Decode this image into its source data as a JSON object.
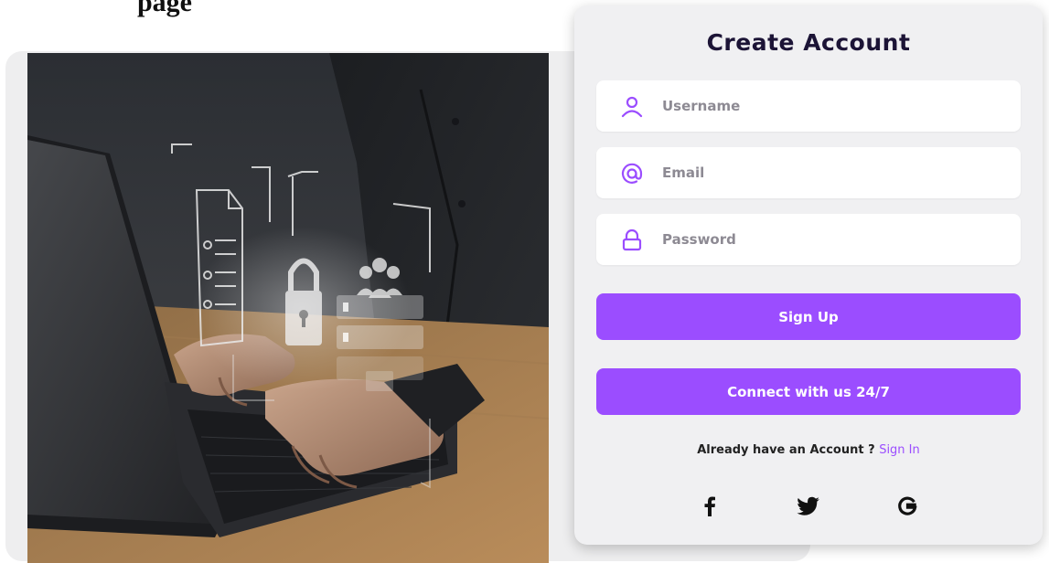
{
  "page": {
    "clipped_heading": "page"
  },
  "form": {
    "title": "Create Account",
    "username_placeholder": "Username",
    "email_placeholder": "Email",
    "password_placeholder": "Password",
    "signup_label": "Sign Up",
    "connect_label": "Connect with us 24/7",
    "already_text": "Already have an Account ? ",
    "signin_label": "Sign In",
    "icons": {
      "username": "user-icon",
      "email": "at-sign-icon",
      "password": "lock-icon"
    }
  },
  "social": [
    {
      "icon": "facebook-icon",
      "glyph": "f"
    },
    {
      "icon": "twitter-icon",
      "glyph": "bird"
    },
    {
      "icon": "google-icon",
      "glyph": "G"
    }
  ],
  "theme": {
    "accent": "#9b4dff",
    "title_color": "#1c1436",
    "card_bg": "#f0f0f2"
  }
}
